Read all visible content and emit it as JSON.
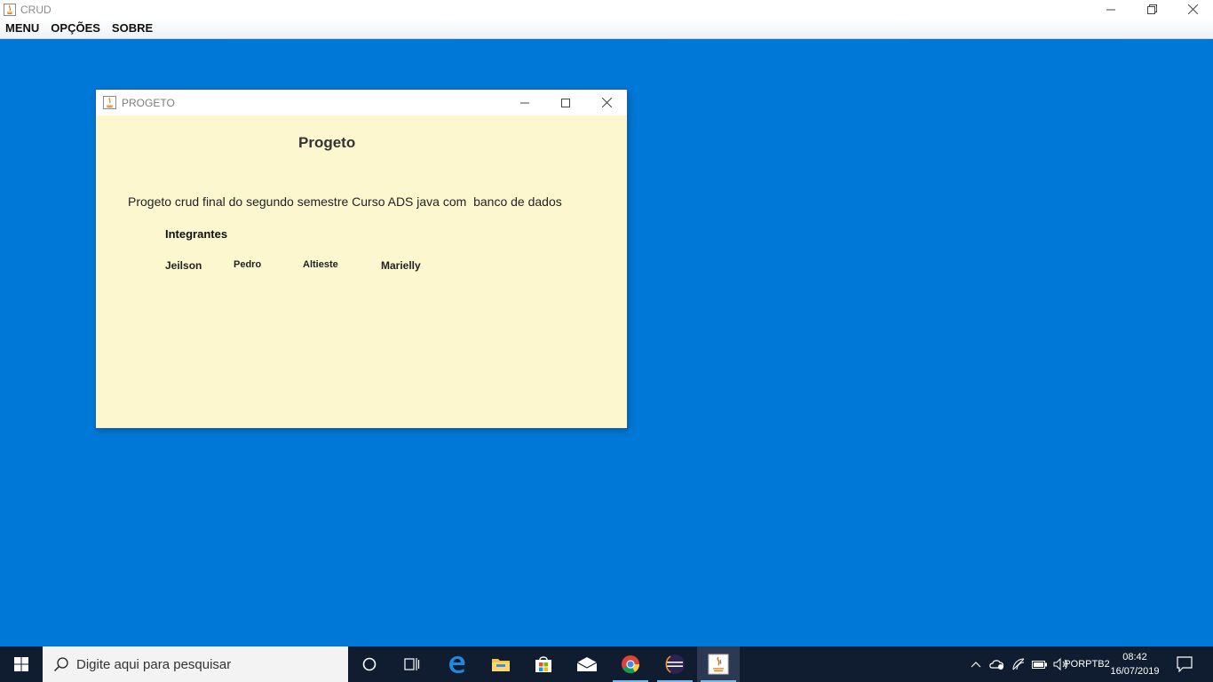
{
  "app": {
    "title": "CRUD",
    "menus": [
      "MENU",
      "OPÇÕES",
      "SOBRE"
    ]
  },
  "dialog": {
    "title": "PROGETO",
    "heading": "Progeto",
    "description": "Progeto crud final do segundo semestre Curso ADS java com  banco de dados",
    "members_label": "Integrantes",
    "members": [
      "Jeilson",
      "Pedro",
      "Altieste",
      "Marielly"
    ]
  },
  "taskbar": {
    "search_placeholder": "Digite aqui para pesquisar",
    "language": "POR",
    "keyboard": "PTB2",
    "time": "08:42",
    "date": "16/07/2019"
  },
  "colors": {
    "desktop": "#0078d7",
    "dialog_background": "#fdf7d0",
    "taskbar": "#101d31"
  },
  "icons": [
    "java-icon",
    "minimize-icon",
    "restore-icon",
    "close-icon",
    "windows-start-icon",
    "search-icon",
    "cortana-icon",
    "task-view-icon",
    "edge-icon",
    "file-explorer-icon",
    "store-icon",
    "mail-icon",
    "chrome-icon",
    "eclipse-icon",
    "chevron-up-icon",
    "network-icon",
    "wifi-icon",
    "battery-icon",
    "volume-icon",
    "notification-icon"
  ]
}
